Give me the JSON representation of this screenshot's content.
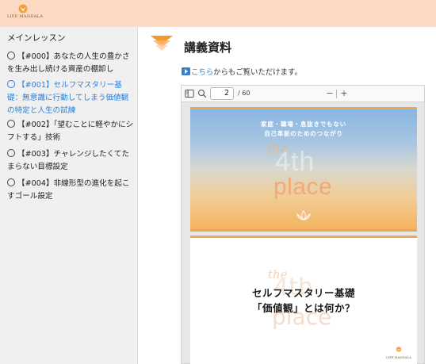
{
  "header": {
    "logo_text": "LIFE MANDALA"
  },
  "sidebar": {
    "title": "メインレッスン",
    "lessons": [
      {
        "label": "【#000】あなたの人生の豊かさを生み出し続ける資産の棚卸し"
      },
      {
        "label": "【#001】セルフマスタリー基礎：無意識に行動してしまう価値観の特定と人生の試練"
      },
      {
        "label": "【#002】「望むことに軽やかにシフトする」技術"
      },
      {
        "label": "【#003】チャレンジしたくてたまらない目標設定"
      },
      {
        "label": "【#004】非線形型の進化を起こすゴール設定"
      }
    ]
  },
  "main": {
    "heading": "講義資料",
    "link_text": "こちら",
    "link_suffix": "からもご覧いただけます。"
  },
  "viewer": {
    "current_page": "2",
    "total_pages": "/ 60",
    "slide1": {
      "line1": "家庭・職場・息抜きでもない",
      "line2": "自己革新のためのつながり",
      "the": "the",
      "word_4th": "4th",
      "place": "place"
    },
    "slide2": {
      "the": "the",
      "word_4th": "4th",
      "place": "place",
      "title_line1": "セルフマスタリー基礎",
      "title_line2": "「価値観」とは何か？",
      "logo_text": "LIFE MANDALA"
    }
  },
  "colors": {
    "header_bg": "#fdd9c4",
    "accent_blue": "#2c82d8",
    "accent_orange": "#f39a2b"
  }
}
